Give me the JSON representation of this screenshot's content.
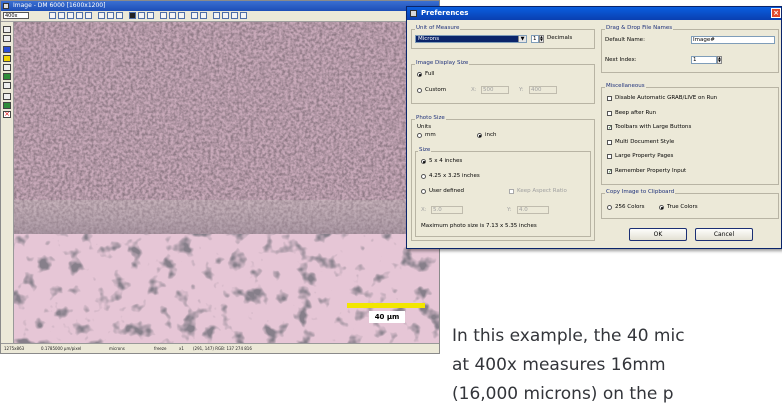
{
  "image_window": {
    "title": "Image - DM 6000 [1600x1200]",
    "zoom_value": "400x",
    "scale_bar_label": "40 µm",
    "status": {
      "coords": "1275x863",
      "calibration": "0.1785000 µm/pixel",
      "unit": "microns",
      "mode": "freeze",
      "zoom": "x1",
      "rgb": "(291, 147) RGB: 137 274 816"
    }
  },
  "dialog": {
    "title": "Preferences",
    "close_glyph": "×",
    "unit_of_measure": {
      "group_label": "Unit of Measure",
      "selected": "Microns",
      "decimals_value": "1",
      "decimals_label": "Decimals"
    },
    "image_display_size": {
      "group_label": "Image Display Size",
      "full_label": "Full",
      "custom_label": "Custom",
      "x_label": "X:",
      "x_value": "500",
      "y_label": "Y:",
      "y_value": "400"
    },
    "photo_size": {
      "group_label": "Photo Size",
      "units_label": "Units",
      "mm_label": "mm",
      "inch_label": "inch",
      "size_label": "Size",
      "option_1": "5 x 4 inches",
      "option_2": "4.25 x 3.25 inches",
      "option_3": "User defined",
      "keep_aspect_label": "Keep Aspect Ratio",
      "x_label": "X:",
      "x_value": "5.0",
      "y_label": "Y:",
      "y_value": "4.0",
      "max_note": "Maximum photo size is 7.13 x 5.35 inches"
    },
    "drag_drop": {
      "group_label": "Drag & Drop File Names",
      "default_name_label": "Default Name:",
      "default_name_value": "Image#",
      "next_index_label": "Next Index:",
      "next_index_value": "1"
    },
    "misc": {
      "group_label": "Miscellaneous",
      "items": [
        {
          "label": "Disable Automatic GRAB/LIVE on Run",
          "checked": false
        },
        {
          "label": "Beep after Run",
          "checked": false
        },
        {
          "label": "Toolbars with Large Buttons",
          "checked": true
        },
        {
          "label": "Multi Document Style",
          "checked": false
        },
        {
          "label": "Large Property Pages",
          "checked": false
        },
        {
          "label": "Remember Property Input",
          "checked": true
        }
      ]
    },
    "clipboard": {
      "group_label": "Copy Image to Clipboard",
      "colors_256_label": "256 Colors",
      "true_colors_label": "True Colors"
    },
    "ok_label": "OK",
    "cancel_label": "Cancel"
  },
  "caption": {
    "line1": "In this example, the 40 mic",
    "line2": "at 400x measures 16mm",
    "line3": "(16,000 microns) on the p"
  },
  "colors": {
    "title_blue": "#0a3fb0",
    "scale_bar": "#f2e600",
    "dialog_face": "#ece9d8"
  }
}
